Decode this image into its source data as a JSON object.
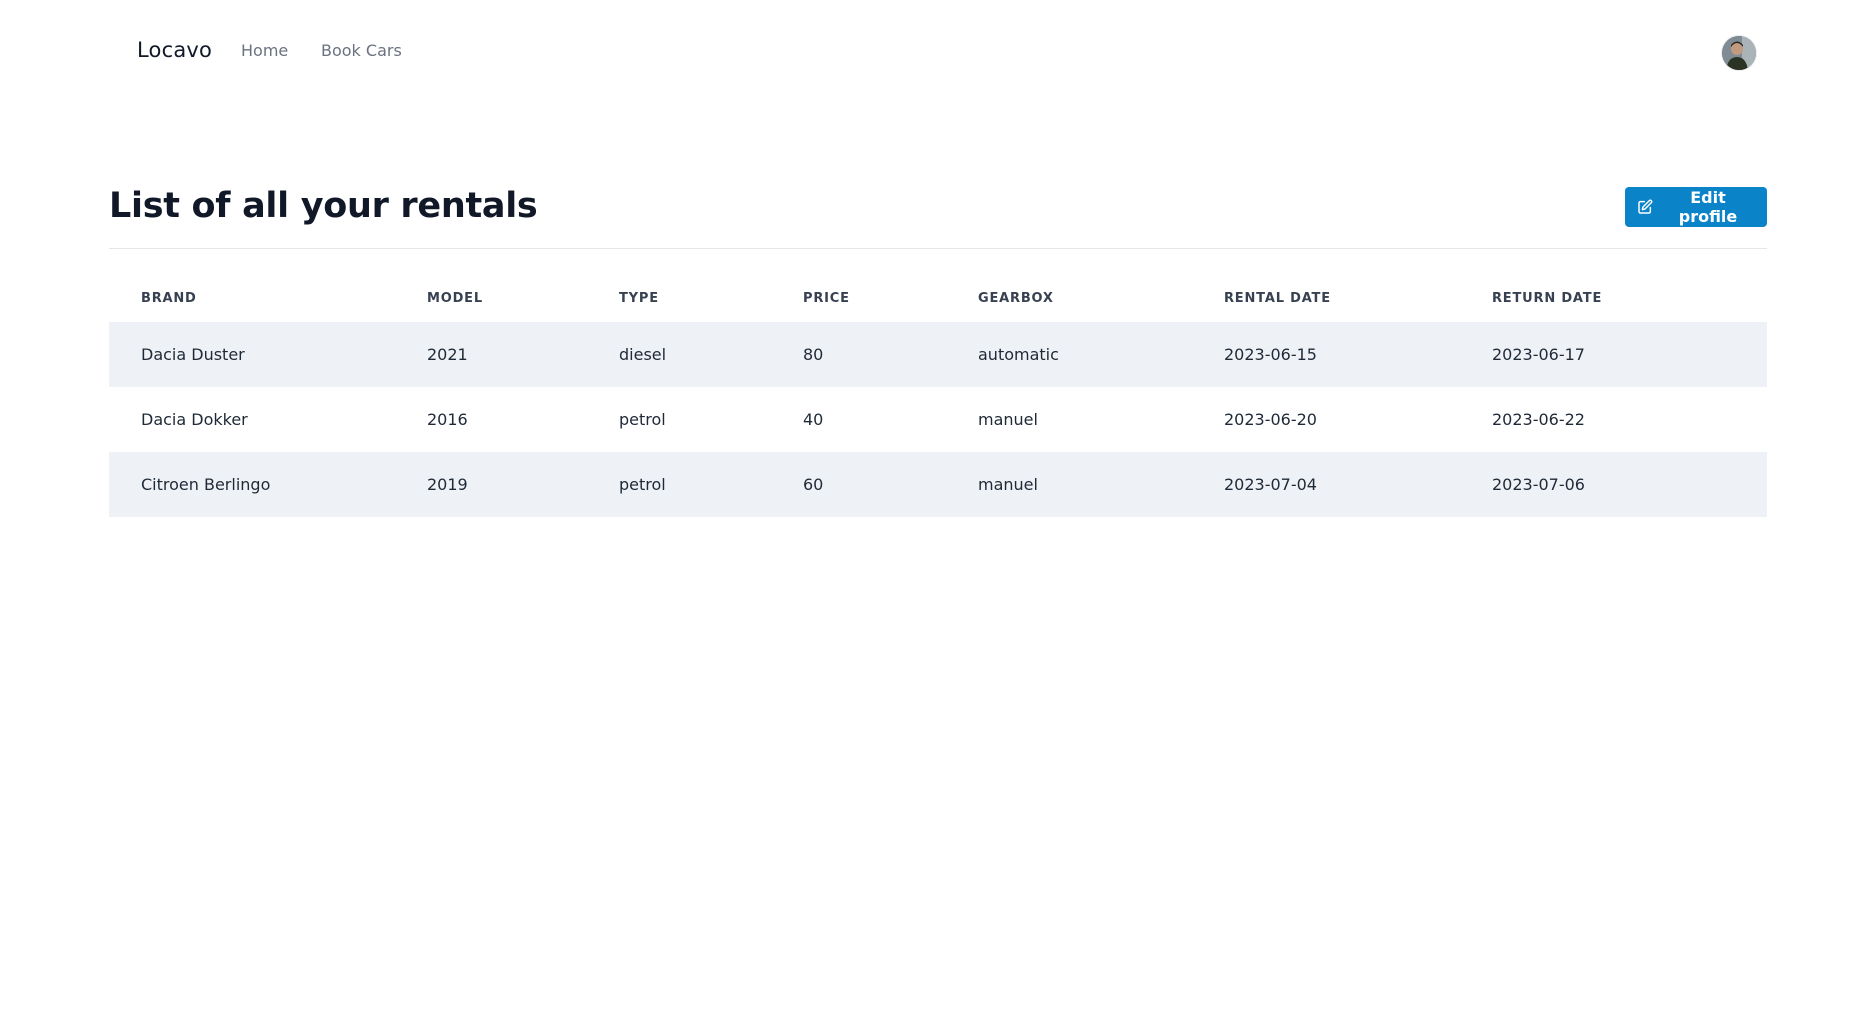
{
  "nav": {
    "brand": "Locavo",
    "links": [
      {
        "label": "Home"
      },
      {
        "label": "Book Cars"
      }
    ],
    "avatar_icon": "user-avatar-photo"
  },
  "header": {
    "title": "List of all your rentals",
    "edit_button_label": "Edit profile",
    "edit_button_icon": "edit-square-icon",
    "accent_color": "#0a83c9"
  },
  "table": {
    "columns": [
      "BRAND",
      "MODEL",
      "TYPE",
      "PRICE",
      "GEARBOX",
      "RENTAL DATE",
      "RETURN DATE"
    ],
    "rows": [
      {
        "brand": "Dacia Duster",
        "model": "2021",
        "type": "diesel",
        "price": "80",
        "gearbox": "automatic",
        "rental_date": "2023-06-15",
        "return_date": "2023-06-17"
      },
      {
        "brand": "Dacia Dokker",
        "model": "2016",
        "type": "petrol",
        "price": "40",
        "gearbox": "manuel",
        "rental_date": "2023-06-20",
        "return_date": "2023-06-22"
      },
      {
        "brand": "Citroen Berlingo",
        "model": "2019",
        "type": "petrol",
        "price": "60",
        "gearbox": "manuel",
        "rental_date": "2023-07-04",
        "return_date": "2023-07-06"
      }
    ]
  }
}
